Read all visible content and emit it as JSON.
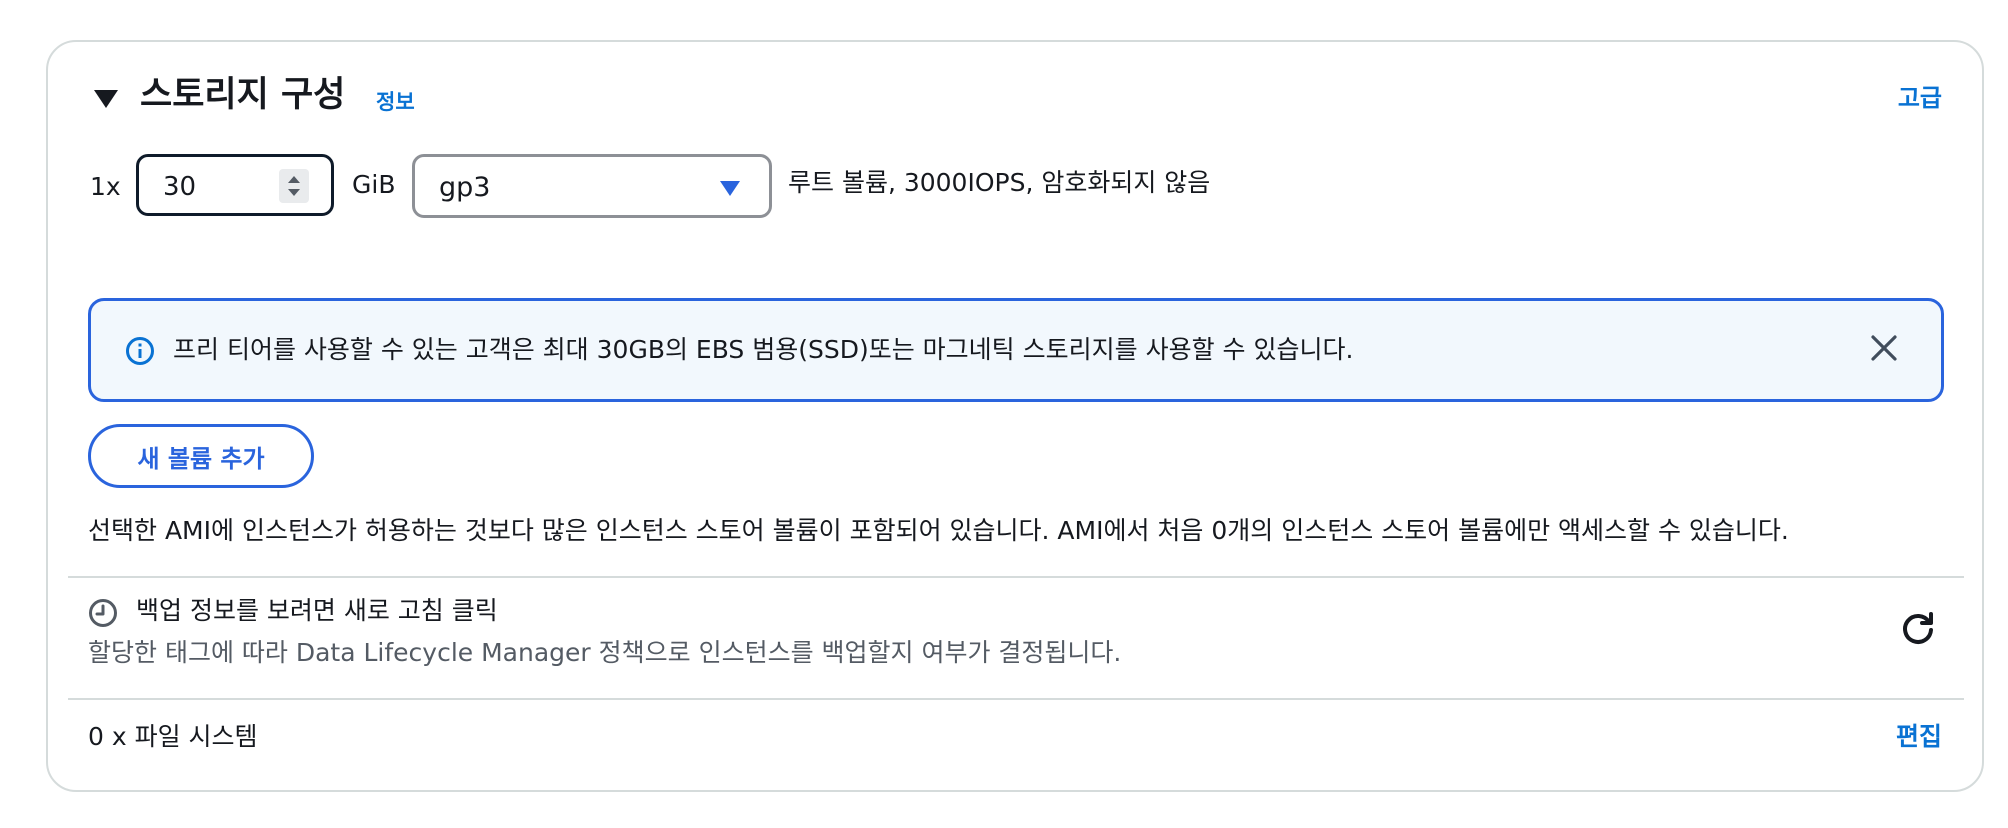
{
  "header": {
    "title": "스토리지 구성",
    "info_link": "정보",
    "advanced_link": "고급"
  },
  "volume": {
    "multiplier": "1x",
    "size_value": "30",
    "unit": "GiB",
    "volume_type": "gp3",
    "description": "루트 볼륨,  3000IOPS,  암호화되지 않음"
  },
  "alert": {
    "text": "프리 티어를 사용할 수 있는 고객은 최대 30GB의 EBS 범용(SSD)또는 마그네틱 스토리지를 사용할 수 있습니다."
  },
  "add_volume_button": "새 볼륨 추가",
  "ami_note": "선택한 AMI에 인스턴스가 허용하는 것보다 많은 인스턴스 스토어 볼륨이 포함되어 있습니다. AMI에서 처음 0개의 인스턴스 스토어 볼륨에만 액세스할 수 있습니다.",
  "backup": {
    "title": "백업 정보를 보려면 새로 고침 클릭",
    "description": "할당한 태그에 따라 Data Lifecycle Manager 정책으로 인스턴스를 백업할지 여부가 결정됩니다."
  },
  "file_systems": {
    "label": "0 x 파일 시스템",
    "edit_link": "편집"
  },
  "colors": {
    "link": "#0972d3",
    "alert_border": "#2a64dd",
    "alert_background": "#f2f8fd",
    "panel_border": "#d5dbdb"
  },
  "icons": [
    "caret-down-icon",
    "info-icon",
    "close-icon",
    "clock-icon",
    "refresh-icon",
    "spinner-arrows-icon",
    "dropdown-caret-icon"
  ]
}
